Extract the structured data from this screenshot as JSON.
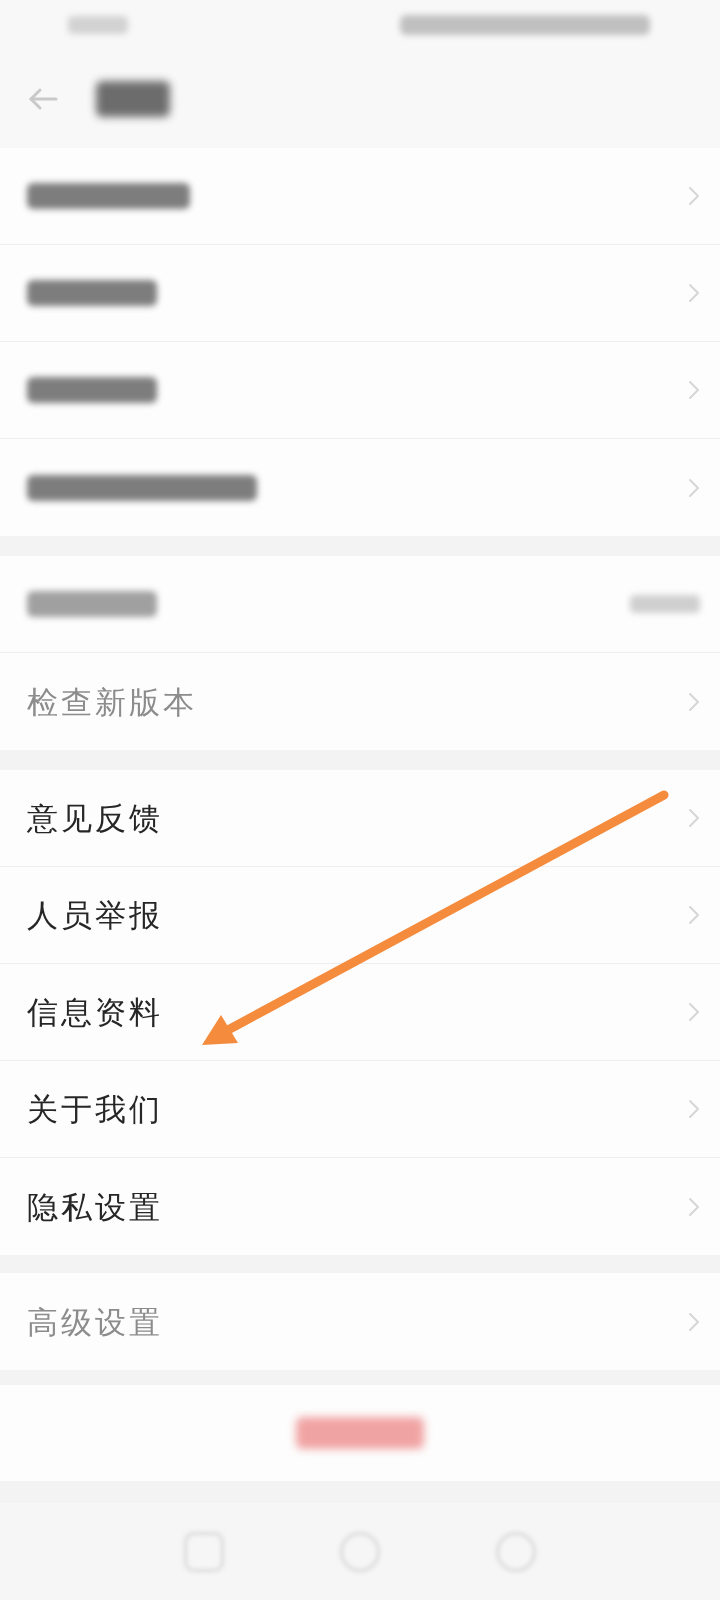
{
  "groups": [
    {
      "rows": [
        {
          "kind": "blurred"
        },
        {
          "kind": "blurred"
        },
        {
          "kind": "blurred"
        },
        {
          "kind": "blurred"
        }
      ]
    },
    {
      "rows": [
        {
          "kind": "blurred_value"
        },
        {
          "kind": "text",
          "label": "检查新版本",
          "dimmed": true
        }
      ]
    },
    {
      "rows": [
        {
          "kind": "text",
          "label": "意见反馈",
          "dimmed": false
        },
        {
          "kind": "text",
          "label": "人员举报",
          "dimmed": false
        },
        {
          "kind": "text",
          "label": "信息资料",
          "dimmed": false
        },
        {
          "kind": "text",
          "label": "关于我们",
          "dimmed": false
        },
        {
          "kind": "text",
          "label": "隐私设置",
          "dimmed": false
        }
      ]
    },
    {
      "rows": [
        {
          "kind": "text",
          "label": "高级设置",
          "dimmed": true
        }
      ]
    }
  ]
}
